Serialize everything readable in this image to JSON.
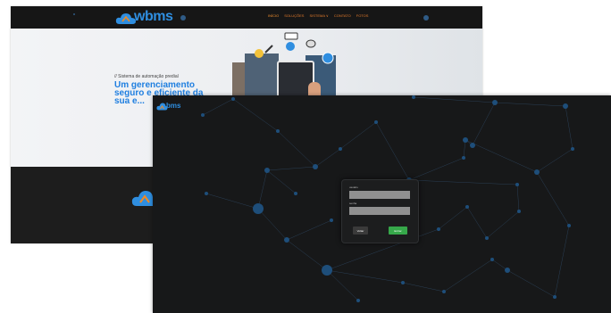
{
  "site": {
    "logo_text": "wbms",
    "nav_items": [
      "INÍCIO",
      "SOLUÇÕES",
      "SISTEMA ∨",
      "CONTATO",
      "FOTOS"
    ],
    "hero_eyebrow": "// Sistema de automação predial",
    "hero_title": "Um gerenciamento seguro e eficiente da sua e...",
    "colors": {
      "brand_blue": "#2f8ee0",
      "brand_orange": "#f08a24",
      "nav_bg": "#161616"
    }
  },
  "login": {
    "logo_text": "bms",
    "user_label": "usuário",
    "user_value": "",
    "password_label": "senha",
    "password_value": "",
    "back_button": "Voltar",
    "submit_button": "Entrar",
    "colors": {
      "background": "#171819",
      "node": "#1e4e7a",
      "accent_green": "#36a84a"
    }
  }
}
